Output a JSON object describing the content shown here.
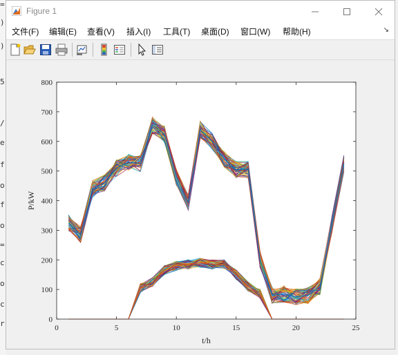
{
  "background_fragments": [
    "=",
    ")",
    ")",
    "5",
    "/",
    "e",
    "f",
    "or",
    "f",
    "or",
    "=",
    "c",
    "o",
    "c",
    "r"
  ],
  "window": {
    "title": "Figure 1",
    "controls": [
      "minimize-icon",
      "maximize-icon",
      "close-icon"
    ]
  },
  "menu": {
    "items": [
      "文件(F)",
      "编辑(E)",
      "查看(V)",
      "插入(I)",
      "工具(T)",
      "桌面(D)",
      "窗口(W)",
      "帮助(H)"
    ]
  },
  "toolbar": {
    "icons": [
      "new-figure-icon",
      "open-file-icon",
      "save-icon",
      "print-icon",
      "link-plot-icon",
      "colorbar-icon",
      "legend-icon",
      "edit-plot-arrow-icon",
      "property-inspector-icon"
    ]
  },
  "colors": {
    "series_palette": [
      "#0072bd",
      "#d95319",
      "#edb120",
      "#7e2f8e",
      "#77ac30",
      "#4dbeee",
      "#a2142f"
    ]
  },
  "chart_data": {
    "type": "line",
    "title": "",
    "xlabel": "t/h",
    "ylabel": "P/kW",
    "xlim": [
      0,
      25
    ],
    "ylim": [
      0,
      800
    ],
    "xticks": [
      0,
      5,
      10,
      15,
      20,
      25
    ],
    "yticks": [
      0,
      100,
      200,
      300,
      400,
      500,
      600,
      700,
      800
    ],
    "grid": false,
    "legend": "none",
    "x": [
      1,
      2,
      3,
      4,
      5,
      6,
      7,
      8,
      9,
      10,
      11,
      12,
      13,
      14,
      15,
      16,
      17,
      18,
      19,
      20,
      21,
      22,
      23,
      24
    ],
    "series": [
      {
        "values": [
          325,
          285,
          440,
          460,
          510,
          530,
          525,
          655,
          625,
          480,
          395,
          640,
          600,
          540,
          505,
          505,
          200,
          80,
          85,
          75,
          80,
          110,
          320,
          525
        ]
      },
      {
        "values": [
          0,
          0,
          0,
          0,
          0,
          0,
          105,
          125,
          165,
          180,
          185,
          190,
          185,
          185,
          150,
          110,
          85,
          0,
          0,
          0,
          0,
          0,
          0,
          0
        ]
      }
    ]
  }
}
